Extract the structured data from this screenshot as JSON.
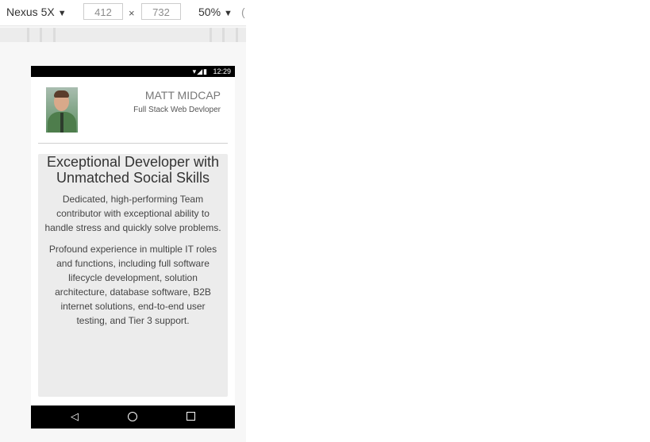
{
  "devtools": {
    "device": "Nexus 5X",
    "width_value": "412",
    "height_value": "732",
    "times": "×",
    "zoom": "50%",
    "caret": "▼",
    "extra": "("
  },
  "phone": {
    "status_icons": "▾◢▮",
    "time": "12:29",
    "profile": {
      "name": "MATT MIDCAP",
      "title": "Full Stack Web Devloper"
    },
    "card": {
      "heading": "Exceptional Developer with Unmatched Social Skills",
      "paragraph1": "Dedicated, high-performing Team contributor with exceptional ability to handle stress and quickly solve problems.",
      "paragraph2": "Profound experience in multiple IT roles and functions, including full software lifecycle development, solution architecture, database software, B2B internet solutions, end-to-end user testing, and Tier 3 support."
    },
    "nav": {
      "back": "◁"
    }
  }
}
